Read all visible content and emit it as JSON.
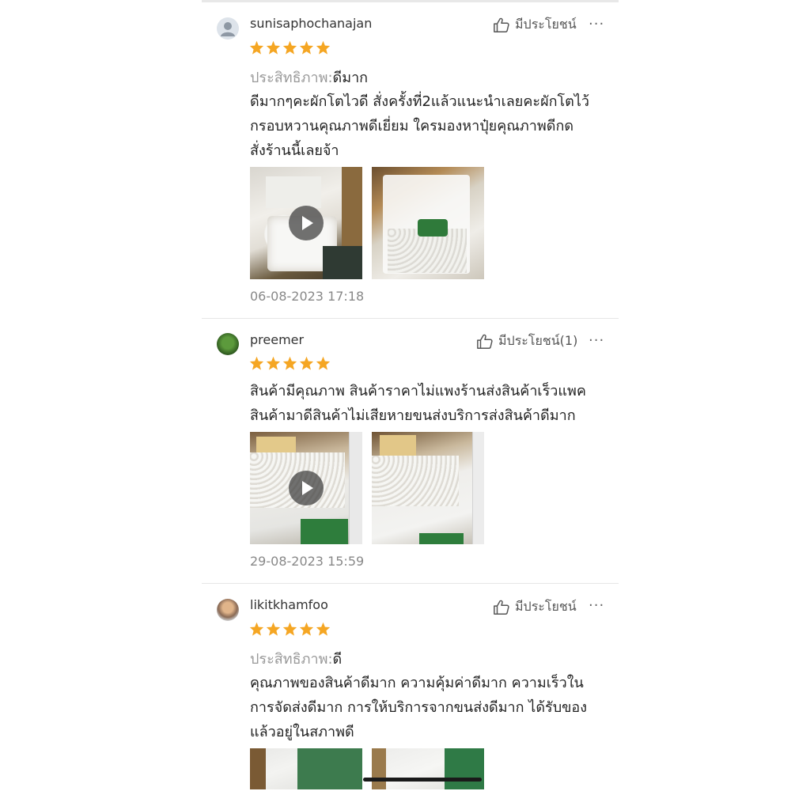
{
  "reviews": [
    {
      "username": "sunisaphochanajan",
      "helpful_label": "มีประโยชน์",
      "more_label": "···",
      "rating": 5,
      "performance_label": "ประสิทธิภาพ:",
      "performance_value": "ดีมาก",
      "body_lines": [
        "ดีมากๆคะผักโตไวดี สั่งครั้งที่2แล้วแนะนำเลยคะผักโตไว้",
        "กรอบหวานคุณภาพดีเยี่ยม ใครมองหาปุ๋ยคุณภาพดีกด",
        "สั่งร้านนี้เลยจ้า"
      ],
      "date": "06-08-2023 17:18"
    },
    {
      "username": "preemer",
      "helpful_label": "มีประโยชน์(1)",
      "more_label": "···",
      "rating": 5,
      "body_lines": [
        "สินค้ามีคุณภาพ สินค้าราคาไม่แพงร้านส่งสินค้าเร็วแพค",
        "สินค้ามาดีสินค้าไม่เสียหายขนส่งบริการส่งสินค้าดีมาก"
      ],
      "date": "29-08-2023 15:59"
    },
    {
      "username": "likitkhamfoo",
      "helpful_label": "มีประโยชน์",
      "more_label": "···",
      "rating": 5,
      "performance_label": "ประสิทธิภาพ:",
      "performance_value": "ดี",
      "body_lines": [
        "คุณภาพของสินค้าดีมาก ความคุ้มค่าดีมาก ความเร็วใน",
        "การจัดส่งดีมาก การให้บริการจากขนส่งดีมาก ได้รับของ",
        "แล้วอยู่ในสภาพดี"
      ]
    }
  ],
  "colors": {
    "star": "#f5a623",
    "meta_text": "#999999",
    "body_text": "#222222",
    "divider": "#e6e6e6"
  }
}
